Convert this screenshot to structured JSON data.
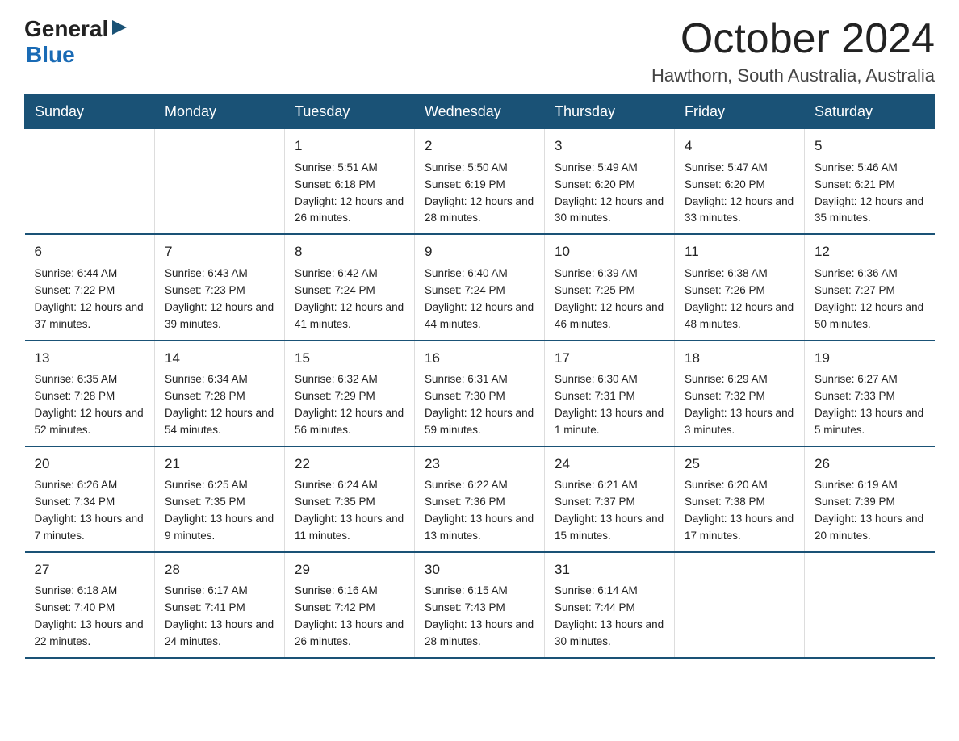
{
  "logo": {
    "general": "General",
    "arrow": "▶",
    "blue": "Blue"
  },
  "header": {
    "month": "October 2024",
    "location": "Hawthorn, South Australia, Australia"
  },
  "days_of_week": [
    "Sunday",
    "Monday",
    "Tuesday",
    "Wednesday",
    "Thursday",
    "Friday",
    "Saturday"
  ],
  "weeks": [
    [
      {
        "day": "",
        "sunrise": "",
        "sunset": "",
        "daylight": ""
      },
      {
        "day": "",
        "sunrise": "",
        "sunset": "",
        "daylight": ""
      },
      {
        "day": "1",
        "sunrise": "Sunrise: 5:51 AM",
        "sunset": "Sunset: 6:18 PM",
        "daylight": "Daylight: 12 hours and 26 minutes."
      },
      {
        "day": "2",
        "sunrise": "Sunrise: 5:50 AM",
        "sunset": "Sunset: 6:19 PM",
        "daylight": "Daylight: 12 hours and 28 minutes."
      },
      {
        "day": "3",
        "sunrise": "Sunrise: 5:49 AM",
        "sunset": "Sunset: 6:20 PM",
        "daylight": "Daylight: 12 hours and 30 minutes."
      },
      {
        "day": "4",
        "sunrise": "Sunrise: 5:47 AM",
        "sunset": "Sunset: 6:20 PM",
        "daylight": "Daylight: 12 hours and 33 minutes."
      },
      {
        "day": "5",
        "sunrise": "Sunrise: 5:46 AM",
        "sunset": "Sunset: 6:21 PM",
        "daylight": "Daylight: 12 hours and 35 minutes."
      }
    ],
    [
      {
        "day": "6",
        "sunrise": "Sunrise: 6:44 AM",
        "sunset": "Sunset: 7:22 PM",
        "daylight": "Daylight: 12 hours and 37 minutes."
      },
      {
        "day": "7",
        "sunrise": "Sunrise: 6:43 AM",
        "sunset": "Sunset: 7:23 PM",
        "daylight": "Daylight: 12 hours and 39 minutes."
      },
      {
        "day": "8",
        "sunrise": "Sunrise: 6:42 AM",
        "sunset": "Sunset: 7:24 PM",
        "daylight": "Daylight: 12 hours and 41 minutes."
      },
      {
        "day": "9",
        "sunrise": "Sunrise: 6:40 AM",
        "sunset": "Sunset: 7:24 PM",
        "daylight": "Daylight: 12 hours and 44 minutes."
      },
      {
        "day": "10",
        "sunrise": "Sunrise: 6:39 AM",
        "sunset": "Sunset: 7:25 PM",
        "daylight": "Daylight: 12 hours and 46 minutes."
      },
      {
        "day": "11",
        "sunrise": "Sunrise: 6:38 AM",
        "sunset": "Sunset: 7:26 PM",
        "daylight": "Daylight: 12 hours and 48 minutes."
      },
      {
        "day": "12",
        "sunrise": "Sunrise: 6:36 AM",
        "sunset": "Sunset: 7:27 PM",
        "daylight": "Daylight: 12 hours and 50 minutes."
      }
    ],
    [
      {
        "day": "13",
        "sunrise": "Sunrise: 6:35 AM",
        "sunset": "Sunset: 7:28 PM",
        "daylight": "Daylight: 12 hours and 52 minutes."
      },
      {
        "day": "14",
        "sunrise": "Sunrise: 6:34 AM",
        "sunset": "Sunset: 7:28 PM",
        "daylight": "Daylight: 12 hours and 54 minutes."
      },
      {
        "day": "15",
        "sunrise": "Sunrise: 6:32 AM",
        "sunset": "Sunset: 7:29 PM",
        "daylight": "Daylight: 12 hours and 56 minutes."
      },
      {
        "day": "16",
        "sunrise": "Sunrise: 6:31 AM",
        "sunset": "Sunset: 7:30 PM",
        "daylight": "Daylight: 12 hours and 59 minutes."
      },
      {
        "day": "17",
        "sunrise": "Sunrise: 6:30 AM",
        "sunset": "Sunset: 7:31 PM",
        "daylight": "Daylight: 13 hours and 1 minute."
      },
      {
        "day": "18",
        "sunrise": "Sunrise: 6:29 AM",
        "sunset": "Sunset: 7:32 PM",
        "daylight": "Daylight: 13 hours and 3 minutes."
      },
      {
        "day": "19",
        "sunrise": "Sunrise: 6:27 AM",
        "sunset": "Sunset: 7:33 PM",
        "daylight": "Daylight: 13 hours and 5 minutes."
      }
    ],
    [
      {
        "day": "20",
        "sunrise": "Sunrise: 6:26 AM",
        "sunset": "Sunset: 7:34 PM",
        "daylight": "Daylight: 13 hours and 7 minutes."
      },
      {
        "day": "21",
        "sunrise": "Sunrise: 6:25 AM",
        "sunset": "Sunset: 7:35 PM",
        "daylight": "Daylight: 13 hours and 9 minutes."
      },
      {
        "day": "22",
        "sunrise": "Sunrise: 6:24 AM",
        "sunset": "Sunset: 7:35 PM",
        "daylight": "Daylight: 13 hours and 11 minutes."
      },
      {
        "day": "23",
        "sunrise": "Sunrise: 6:22 AM",
        "sunset": "Sunset: 7:36 PM",
        "daylight": "Daylight: 13 hours and 13 minutes."
      },
      {
        "day": "24",
        "sunrise": "Sunrise: 6:21 AM",
        "sunset": "Sunset: 7:37 PM",
        "daylight": "Daylight: 13 hours and 15 minutes."
      },
      {
        "day": "25",
        "sunrise": "Sunrise: 6:20 AM",
        "sunset": "Sunset: 7:38 PM",
        "daylight": "Daylight: 13 hours and 17 minutes."
      },
      {
        "day": "26",
        "sunrise": "Sunrise: 6:19 AM",
        "sunset": "Sunset: 7:39 PM",
        "daylight": "Daylight: 13 hours and 20 minutes."
      }
    ],
    [
      {
        "day": "27",
        "sunrise": "Sunrise: 6:18 AM",
        "sunset": "Sunset: 7:40 PM",
        "daylight": "Daylight: 13 hours and 22 minutes."
      },
      {
        "day": "28",
        "sunrise": "Sunrise: 6:17 AM",
        "sunset": "Sunset: 7:41 PM",
        "daylight": "Daylight: 13 hours and 24 minutes."
      },
      {
        "day": "29",
        "sunrise": "Sunrise: 6:16 AM",
        "sunset": "Sunset: 7:42 PM",
        "daylight": "Daylight: 13 hours and 26 minutes."
      },
      {
        "day": "30",
        "sunrise": "Sunrise: 6:15 AM",
        "sunset": "Sunset: 7:43 PM",
        "daylight": "Daylight: 13 hours and 28 minutes."
      },
      {
        "day": "31",
        "sunrise": "Sunrise: 6:14 AM",
        "sunset": "Sunset: 7:44 PM",
        "daylight": "Daylight: 13 hours and 30 minutes."
      },
      {
        "day": "",
        "sunrise": "",
        "sunset": "",
        "daylight": ""
      },
      {
        "day": "",
        "sunrise": "",
        "sunset": "",
        "daylight": ""
      }
    ]
  ]
}
